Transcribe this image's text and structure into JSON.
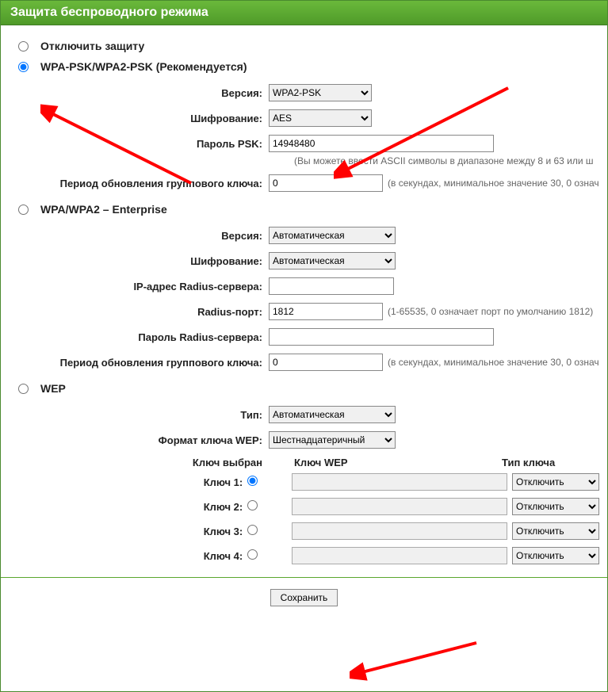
{
  "header": {
    "title": "Защита беспроводного режима"
  },
  "sec_disable": {
    "label": "Отключить защиту"
  },
  "sec_wpa_psk": {
    "label": "WPA-PSK/WPA2-PSK (Рекомендуется)",
    "version_label": "Версия:",
    "version_value": "WPA2-PSK",
    "encrypt_label": "Шифрование:",
    "encrypt_value": "AES",
    "psk_label": "Пароль PSK:",
    "psk_value": "14948480",
    "psk_hint": "(Вы можете ввести ASCII символы в диапазоне между 8 и 63 или ш",
    "gkupdate_label": "Период обновления группового ключа:",
    "gkupdate_value": "0",
    "gkupdate_hint": "(в секундах, минимальное значение 30, 0 означ"
  },
  "sec_wpa_ent": {
    "label": "WPA/WPA2 – Enterprise",
    "version_label": "Версия:",
    "version_value": "Автоматическая",
    "encrypt_label": "Шифрование:",
    "encrypt_value": "Автоматическая",
    "radius_ip_label": "IP-адрес Radius-сервера:",
    "radius_ip_value": "",
    "radius_port_label": "Radius-порт:",
    "radius_port_value": "1812",
    "radius_port_hint": "(1-65535, 0 означает порт по умолчанию 1812)",
    "radius_pw_label": "Пароль Radius-сервера:",
    "radius_pw_value": "",
    "gkupdate_label": "Период обновления группового ключа:",
    "gkupdate_value": "0",
    "gkupdate_hint": "(в секундах, минимальное значение 30, 0 означ"
  },
  "sec_wep": {
    "label": "WEP",
    "type_label": "Тип:",
    "type_value": "Автоматическая",
    "fmt_label": "Формат ключа WEP:",
    "fmt_value": "Шестнадцатеричный",
    "col_selected": "Ключ выбран",
    "col_wepkey": "Ключ WEP",
    "col_keytype": "Тип ключа",
    "keys": [
      {
        "name": "Ключ 1:",
        "value": "",
        "type": "Отключить"
      },
      {
        "name": "Ключ 2:",
        "value": "",
        "type": "Отключить"
      },
      {
        "name": "Ключ 3:",
        "value": "",
        "type": "Отключить"
      },
      {
        "name": "Ключ 4:",
        "value": "",
        "type": "Отключить"
      }
    ]
  },
  "footer": {
    "save": "Сохранить"
  }
}
